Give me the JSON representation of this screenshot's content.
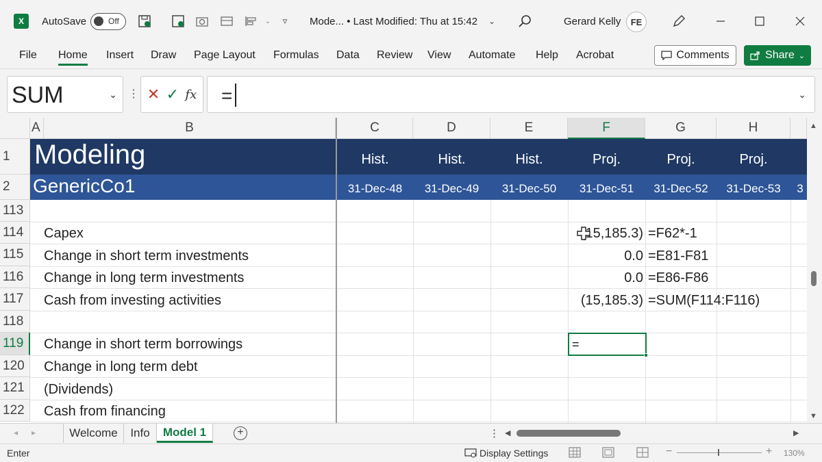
{
  "titlebar": {
    "app_icon": "X",
    "autosave_label": "AutoSave",
    "autosave_state": "Off",
    "doc_title": "Mode...  •  Last Modified: Thu at 15:42",
    "user_name": "Gerard Kelly",
    "avatar_initials": "FE"
  },
  "ribbon": {
    "tabs": [
      "File",
      "Home",
      "Insert",
      "Draw",
      "Page Layout",
      "Formulas",
      "Data",
      "Review",
      "View",
      "Automate",
      "Help",
      "Acrobat"
    ],
    "active_tab": "Home",
    "comments_label": "Comments",
    "share_label": "Share"
  },
  "formula_bar": {
    "name_box": "SUM",
    "fx": "fx",
    "formula": "="
  },
  "grid": {
    "columns": [
      "A",
      "B",
      "C",
      "D",
      "E",
      "F",
      "G",
      "H"
    ],
    "selected_column": "F",
    "title": "Modeling",
    "subtitle": "GenericCo1",
    "period_labels": [
      "Hist.",
      "Hist.",
      "Hist.",
      "Proj.",
      "Proj.",
      "Proj."
    ],
    "period_dates": [
      "31-Dec-48",
      "31-Dec-49",
      "31-Dec-50",
      "31-Dec-51",
      "31-Dec-52",
      "31-Dec-53"
    ],
    "cut_date": "3",
    "top_rows": [
      "1",
      "2"
    ],
    "rows": [
      {
        "num": "113",
        "label": "",
        "f": "",
        "g": ""
      },
      {
        "num": "114",
        "label": "Capex",
        "f": "(15,185.3)",
        "g": "=F62*-1"
      },
      {
        "num": "115",
        "label": "Change in short term investments",
        "f": "0.0",
        "g": "=E81-F81"
      },
      {
        "num": "116",
        "label": "Change in long term investments",
        "f": "0.0",
        "g": "=E86-F86"
      },
      {
        "num": "117",
        "label": "Cash from investing activities",
        "f": "(15,185.3)",
        "g": "=SUM(F114:F116)"
      },
      {
        "num": "118",
        "label": "",
        "f": "",
        "g": ""
      },
      {
        "num": "119",
        "label": "Change in short term borrowings",
        "f": "",
        "g": ""
      },
      {
        "num": "120",
        "label": "Change in long term debt",
        "f": "",
        "g": ""
      },
      {
        "num": "121",
        "label": "(Dividends)",
        "f": "",
        "g": ""
      },
      {
        "num": "122",
        "label": "Cash from financing",
        "f": "",
        "g": ""
      }
    ],
    "active_cell_value": "="
  },
  "sheets": {
    "tabs": [
      "Welcome",
      "Info",
      "Model 1"
    ],
    "active": "Model 1"
  },
  "status": {
    "mode": "Enter",
    "display_settings": "Display Settings",
    "zoom": "130%"
  },
  "colors": {
    "excel_green": "#107c41",
    "band_dark": "#1f3864",
    "band_mid": "#2e5597"
  }
}
